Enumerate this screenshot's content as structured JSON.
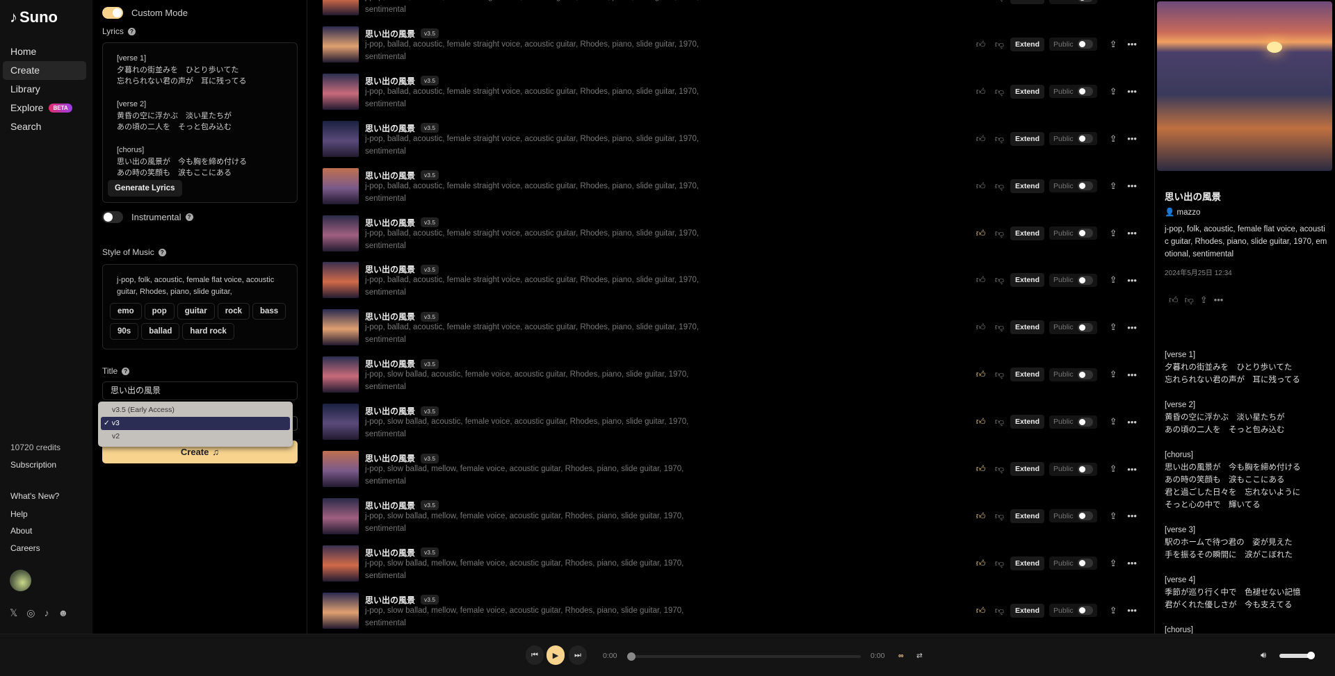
{
  "app": {
    "name": "Suno"
  },
  "sidebar": {
    "items": [
      {
        "label": "Home"
      },
      {
        "label": "Create",
        "active": true
      },
      {
        "label": "Library"
      },
      {
        "label": "Explore",
        "badge": "BETA"
      },
      {
        "label": "Search"
      }
    ],
    "credits": "10720 credits",
    "subscription": "Subscription",
    "links": [
      "What's New?",
      "Help",
      "About",
      "Careers"
    ],
    "social_icons": [
      "x-icon",
      "instagram-icon",
      "tiktok-icon",
      "discord-icon"
    ]
  },
  "create": {
    "custom_mode_label": "Custom Mode",
    "custom_mode_on": true,
    "lyrics_label": "Lyrics",
    "lyrics_value": "[verse 1]\n夕暮れの街並みを　ひとり歩いてた\n忘れられない君の声が　耳に残ってる\n\n[verse 2]\n黄昏の空に浮かぶ　淡い星たちが\nあの頃の二人を　そっと包み込む\n\n[chorus]\n思い出の風景が　今も胸を締め付ける\nあの時の笑顔も　涙もここにある",
    "generate_lyrics": "Generate Lyrics",
    "instrumental_label": "Instrumental",
    "instrumental_on": false,
    "style_label": "Style of Music",
    "style_value": "j-pop, folk, acoustic, female flat voice, acoustic guitar, Rhodes, piano, slide guitar,",
    "style_tags": [
      "emo",
      "pop",
      "guitar",
      "rock",
      "bass",
      "90s",
      "ballad",
      "hard rock"
    ],
    "title_label": "Title",
    "title_value": "思い出の風景",
    "model_options": [
      {
        "label": "v3.5 (Early Access)"
      },
      {
        "label": "v3",
        "selected": true
      },
      {
        "label": "v2"
      }
    ],
    "create_button": "Create",
    "accent": "#f7d38e"
  },
  "songs": {
    "extend_label": "Extend",
    "public_label": "Public",
    "items": [
      {
        "title": "思い出の風景",
        "version": "v3.5",
        "desc": "j-pop, ballad, acoustic, female straight voice, acoustic guitar, Rhodes, piano, slide guitar, 1970, sentimental",
        "liked": false
      },
      {
        "title": "思い出の風景",
        "version": "v3.5",
        "desc": "j-pop, ballad, acoustic, female straight voice, acoustic guitar, Rhodes, piano, slide guitar, 1970, sentimental",
        "liked": false
      },
      {
        "title": "思い出の風景",
        "version": "v3.5",
        "desc": "j-pop, ballad, acoustic, female straight voice, acoustic guitar, Rhodes, piano, slide guitar, 1970, sentimental",
        "liked": false
      },
      {
        "title": "思い出の風景",
        "version": "v3.5",
        "desc": "j-pop, ballad, acoustic, female straight voice, acoustic guitar, Rhodes, piano, slide guitar, 1970, sentimental",
        "liked": false
      },
      {
        "title": "思い出の風景",
        "version": "v3.5",
        "desc": "j-pop, ballad, acoustic, female straight voice, acoustic guitar, Rhodes, piano, slide guitar, 1970, sentimental",
        "liked": false
      },
      {
        "title": "思い出の風景",
        "version": "v3.5",
        "desc": "j-pop, ballad, acoustic, female straight voice, acoustic guitar, Rhodes, piano, slide guitar, 1970, sentimental",
        "liked": true
      },
      {
        "title": "思い出の風景",
        "version": "v3.5",
        "desc": "j-pop, ballad, acoustic, female straight voice, acoustic guitar, Rhodes, piano, slide guitar, 1970, sentimental",
        "liked": false
      },
      {
        "title": "思い出の風景",
        "version": "v3.5",
        "desc": "j-pop, ballad, acoustic, female straight voice, acoustic guitar, Rhodes, piano, slide guitar, 1970, sentimental",
        "liked": false
      },
      {
        "title": "思い出の風景",
        "version": "v3.5",
        "desc": "j-pop, slow ballad, acoustic, female voice, acoustic guitar, Rhodes, piano, slide guitar, 1970, sentimental",
        "liked": true
      },
      {
        "title": "思い出の風景",
        "version": "v3.5",
        "desc": "j-pop, slow ballad, acoustic, female voice, acoustic guitar, Rhodes, piano, slide guitar, 1970, sentimental",
        "liked": true
      },
      {
        "title": "思い出の風景",
        "version": "v3.5",
        "desc": "j-pop, slow ballad, mellow, female voice, acoustic guitar, Rhodes, piano, slide guitar, 1970, sentimental",
        "liked": true
      },
      {
        "title": "思い出の風景",
        "version": "v3.5",
        "desc": "j-pop, slow ballad, mellow, female voice, acoustic guitar, Rhodes, piano, slide guitar, 1970, sentimental",
        "liked": true
      },
      {
        "title": "思い出の風景",
        "version": "v3.5",
        "desc": "j-pop, slow ballad, mellow, female voice, acoustic guitar, Rhodes, piano, slide guitar, 1970, sentimental",
        "liked": true
      },
      {
        "title": "思い出の風景",
        "version": "v3.5",
        "desc": "j-pop, slow ballad, mellow, female voice, acoustic guitar, Rhodes, piano, slide guitar, 1970, sentimental",
        "liked": true
      }
    ]
  },
  "detail": {
    "title": "思い出の風景",
    "author": "mazzo",
    "desc": "j-pop, folk, acoustic, female flat voice, acoustic guitar, Rhodes, piano, slide guitar, 1970, emotional, sentimental",
    "date": "2024年5月25日 12:34",
    "lyrics": "[verse 1]\n夕暮れの街並みを　ひとり歩いてた\n忘れられない君の声が　耳に残ってる\n\n[verse 2]\n黄昏の空に浮かぶ　淡い星たちが\nあの頃の二人を　そっと包み込む\n\n[chorus]\n思い出の風景が　今も胸を締め付ける\nあの時の笑顔も　涙もここにある\n君と過ごした日々を　忘れないように\nそっと心の中で　輝いてる\n\n[verse 3]\n駅のホームで待つ君の　姿が見えた\n手を振るその瞬間に　涙がこぼれた\n\n[verse 4]\n季節が巡り行く中で　色褪せない記憶\n君がくれた優しさが　今も支えてる\n\n[chorus]"
  },
  "player": {
    "current_time": "0:00",
    "duration": "0:00",
    "progress": 0,
    "volume": 1.0
  }
}
